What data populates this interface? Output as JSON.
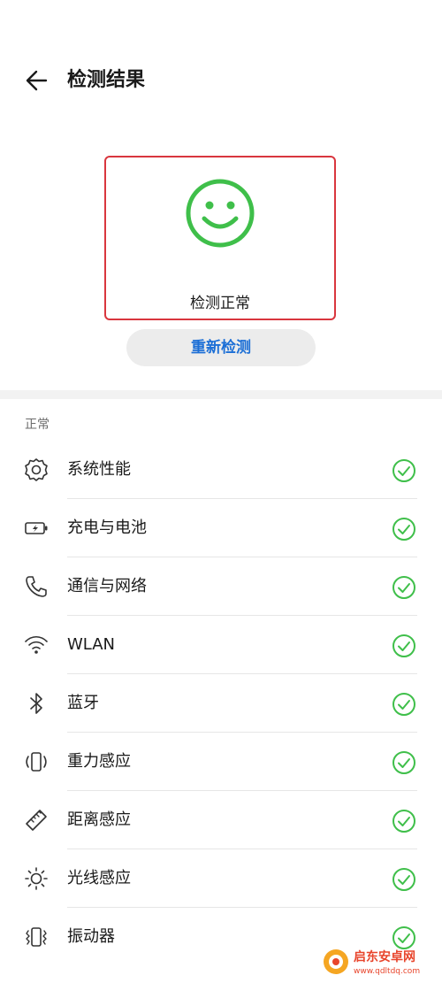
{
  "header": {
    "title": "检测结果",
    "back_icon": "arrow-left-icon"
  },
  "result": {
    "status_label": "检测正常",
    "icon": "smiley-icon",
    "accent_color": "#3fbf4a",
    "border_color": "#d9363e"
  },
  "actions": {
    "retest_label": "重新检测"
  },
  "section": {
    "title": "正常"
  },
  "items": [
    {
      "label": "系统性能",
      "icon": "gear-icon",
      "status": "ok"
    },
    {
      "label": "充电与电池",
      "icon": "battery-charging-icon",
      "status": "ok"
    },
    {
      "label": "通信与网络",
      "icon": "phone-icon",
      "status": "ok"
    },
    {
      "label": "WLAN",
      "icon": "wifi-icon",
      "status": "ok"
    },
    {
      "label": "蓝牙",
      "icon": "bluetooth-icon",
      "status": "ok"
    },
    {
      "label": "重力感应",
      "icon": "gravity-sensor-icon",
      "status": "ok"
    },
    {
      "label": "距离感应",
      "icon": "ruler-icon",
      "status": "ok"
    },
    {
      "label": "光线感应",
      "icon": "brightness-icon",
      "status": "ok"
    },
    {
      "label": "振动器",
      "icon": "vibration-icon",
      "status": "ok"
    }
  ],
  "colors": {
    "check": "#3fbf4a",
    "link": "#1c6fd6"
  },
  "watermark": {
    "text": "启东安卓网",
    "url": "www.qdltdq.com"
  }
}
